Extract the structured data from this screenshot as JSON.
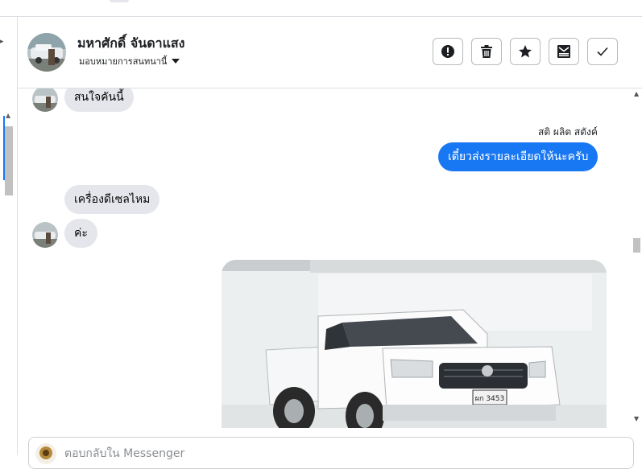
{
  "header": {
    "contact_name": "มหาศักดิ์ จันดาแสง",
    "assign_label": "มอบหมายการสนทนานี้",
    "actions": [
      {
        "name": "spam-button",
        "icon": "alert-icon"
      },
      {
        "name": "delete-button",
        "icon": "trash-icon"
      },
      {
        "name": "star-button",
        "icon": "star-icon"
      },
      {
        "name": "mark-unread-button",
        "icon": "envelope-icon"
      },
      {
        "name": "mark-done-button",
        "icon": "check-icon"
      }
    ]
  },
  "messages": {
    "m1": "สนใจคันนี้",
    "sender": "สติ ผลิต สตังค์",
    "m2": "เดี๋ยวส่งรายละเอียดให้นะครับ",
    "m3": "เครื่องดีเซลไหม",
    "m4": "ค่ะ",
    "plate": "ผก 3453"
  },
  "composer": {
    "placeholder": "ตอบกลับใน Messenger"
  },
  "colors": {
    "outgoing_bubble": "#1877f2",
    "incoming_bubble": "#e4e6eb"
  }
}
